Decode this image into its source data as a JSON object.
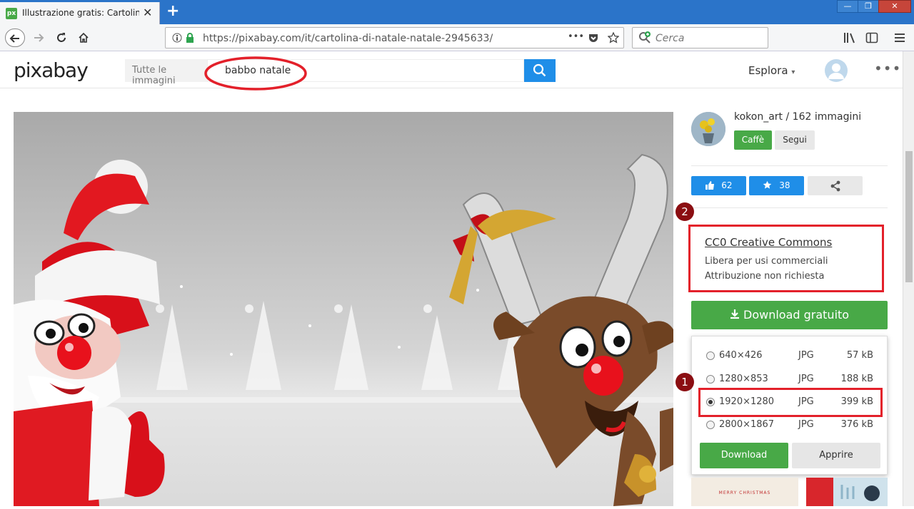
{
  "browser": {
    "tab_title": "Illustrazione gratis: Cartolina Di",
    "tab_icon_text": "px",
    "new_tab_symbol": "+",
    "url": "https://pixabay.com/it/cartolina-di-natale-natale-2945633/",
    "search_placeholder": "Cerca",
    "url_actions_dots": "•••"
  },
  "site": {
    "logo": "pixabay",
    "filter_label": "Tutte le immagini",
    "search_query": "babbo natale",
    "explore_label": "Esplora",
    "more_dots": "•••"
  },
  "author": {
    "line": "kokon_art / 162 immagini",
    "coffee_label": "Caffè",
    "follow_label": "Segui"
  },
  "stats": {
    "likes": "62",
    "favorites": "38"
  },
  "annotations": {
    "badge_1": "1",
    "badge_2": "2"
  },
  "license": {
    "title": "CC0 Creative Commons",
    "line1": "Libera per usi commerciali",
    "line2": "Attribuzione non richiesta"
  },
  "download": {
    "main_label": "Download gratuito",
    "options": [
      {
        "dim": "640×426",
        "fmt": "JPG",
        "size": "57 kB",
        "selected": false
      },
      {
        "dim": "1280×853",
        "fmt": "JPG",
        "size": "188 kB",
        "selected": false
      },
      {
        "dim": "1920×1280",
        "fmt": "JPG",
        "size": "399 kB",
        "selected": true
      },
      {
        "dim": "2800×1867",
        "fmt": "JPG",
        "size": "376 kB",
        "selected": false
      }
    ],
    "download_label": "Download",
    "open_label": "Apprire"
  },
  "thumb_text": "MERRY CHRISTMAS",
  "colors": {
    "green": "#48a947",
    "blue": "#1f8ee8",
    "annotation_red": "#e3202a",
    "badge": "#8b0e12",
    "titlebar": "#2b74c9"
  }
}
